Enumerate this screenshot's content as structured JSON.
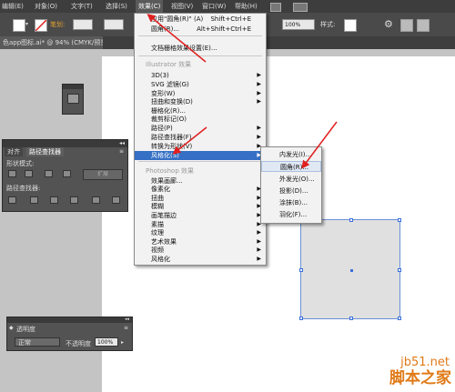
{
  "menubar": {
    "items": [
      "编辑(E)",
      "对象(O)",
      "文字(T)",
      "选择(S)",
      "效果(C)",
      "视图(V)",
      "窗口(W)",
      "帮助(H)"
    ]
  },
  "controlbar": {
    "stroke_label": "笔划:",
    "zoom": "100%",
    "style_label": "样式:",
    "icon": "gear-icon"
  },
  "document": {
    "tab_title": "色app图标.ai* @ 94% (CMYK/预览)"
  },
  "effect_menu": {
    "items": [
      {
        "label": "应用\"圆角(R)\" (A)",
        "shortcut": "Shift+Ctrl+E",
        "submenu": false
      },
      {
        "label": "圆角(R)...",
        "shortcut": "Alt+Shift+Ctrl+E",
        "submenu": false
      },
      {
        "label": "文档栅格效果设置(E)...",
        "shortcut": "",
        "submenu": false
      },
      {
        "label": "Illustrator 效果",
        "shortcut": "",
        "submenu": false,
        "header": true
      },
      {
        "label": "3D(3)",
        "shortcut": "",
        "submenu": true
      },
      {
        "label": "SVG 滤镜(G)",
        "shortcut": "",
        "submenu": true
      },
      {
        "label": "变形(W)",
        "shortcut": "",
        "submenu": true
      },
      {
        "label": "扭曲和变换(D)",
        "shortcut": "",
        "submenu": true
      },
      {
        "label": "栅格化(R)...",
        "shortcut": "",
        "submenu": false
      },
      {
        "label": "裁剪标记(O)",
        "shortcut": "",
        "submenu": false
      },
      {
        "label": "路径(P)",
        "shortcut": "",
        "submenu": true
      },
      {
        "label": "路径查找器(F)",
        "shortcut": "",
        "submenu": true
      },
      {
        "label": "转换为形状(V)",
        "shortcut": "",
        "submenu": true
      },
      {
        "label": "风格化(S)",
        "shortcut": "",
        "submenu": true,
        "highlighted": true
      },
      {
        "label": "Photoshop 效果",
        "shortcut": "",
        "submenu": false,
        "header": true
      },
      {
        "label": "效果画廊...",
        "shortcut": "",
        "submenu": false
      },
      {
        "label": "像素化",
        "shortcut": "",
        "submenu": true
      },
      {
        "label": "扭曲",
        "shortcut": "",
        "submenu": true
      },
      {
        "label": "模糊",
        "shortcut": "",
        "submenu": true
      },
      {
        "label": "画笔描边",
        "shortcut": "",
        "submenu": true
      },
      {
        "label": "素描",
        "shortcut": "",
        "submenu": true
      },
      {
        "label": "纹理",
        "shortcut": "",
        "submenu": true
      },
      {
        "label": "艺术效果",
        "shortcut": "",
        "submenu": true
      },
      {
        "label": "视频",
        "shortcut": "",
        "submenu": true
      },
      {
        "label": "风格化",
        "shortcut": "",
        "submenu": true
      }
    ]
  },
  "stylize_submenu": {
    "items": [
      "内发光(I)...",
      "圆角(R)...",
      "外发光(O)...",
      "投影(D)...",
      "涂抹(B)...",
      "羽化(F)..."
    ]
  },
  "pathfinder_panel": {
    "tabs": [
      "对齐",
      "路径查找器"
    ],
    "shape_modes_label": "形状模式:",
    "expand_label": "扩展",
    "pathfinders_label": "路径查找器:"
  },
  "transparency_panel": {
    "title": "透明度",
    "blend_mode": "正常",
    "opacity_label": "不透明度",
    "opacity_value": "100%"
  },
  "watermark": {
    "site": "jb51.net",
    "name": "脚本之家"
  },
  "colors": {
    "menu_highlight": "#3570c4",
    "arrow_red": "#e02020",
    "watermark": "#e07a17",
    "selection": "#3b6fd9"
  }
}
